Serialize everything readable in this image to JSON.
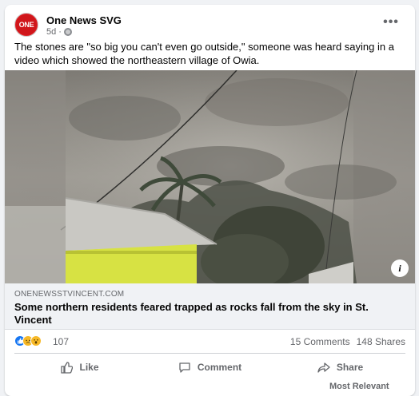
{
  "post": {
    "page_name": "One News SVG",
    "avatar_text": "ONE",
    "time": "5d",
    "separator": "·",
    "text": "The stones are \"so big you can't even go outside,\" someone was heard saying in a video which showed the northeastern village of Owia.",
    "more_label": "•••"
  },
  "link": {
    "domain": "ONENEWSSTVINCENT.COM",
    "title": "Some northern residents feared trapped as rocks fall from the sky in St. Vincent",
    "info_label": "i"
  },
  "stats": {
    "reaction_count": "107",
    "comments": "15 Comments",
    "shares": "148 Shares",
    "reaction_icons": [
      "like-icon",
      "sad-icon",
      "wow-icon"
    ]
  },
  "actions": {
    "like": "Like",
    "comment": "Comment",
    "share": "Share"
  },
  "footer": {
    "partial_text": "Most Relevant"
  },
  "colors": {
    "accent": "#1877f2",
    "brand_red": "#e11d22",
    "secondary_text": "#65676b"
  }
}
